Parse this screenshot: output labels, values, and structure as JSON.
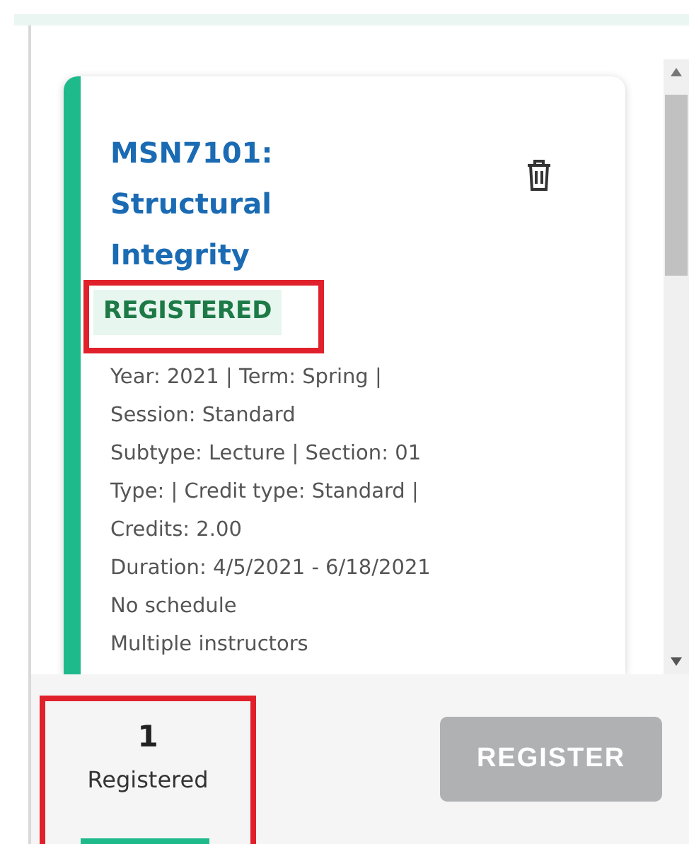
{
  "course": {
    "title": "MSN7101: Structural Integrity",
    "status": {
      "label": "REGISTERED",
      "highlighted": true
    },
    "details": [
      "Year: 2021 | Term: Spring | Session: Standard",
      "Subtype: Lecture | Section: 01",
      "Type: | Credit type: Standard | Credits: 2.00",
      "Duration: 4/5/2021 - 6/18/2021",
      "No schedule",
      "Multiple instructors"
    ]
  },
  "summary": {
    "count": "1",
    "label": "Registered",
    "highlighted": true,
    "selected": true
  },
  "register_button": {
    "label": "REGISTER",
    "disabled": true
  }
}
